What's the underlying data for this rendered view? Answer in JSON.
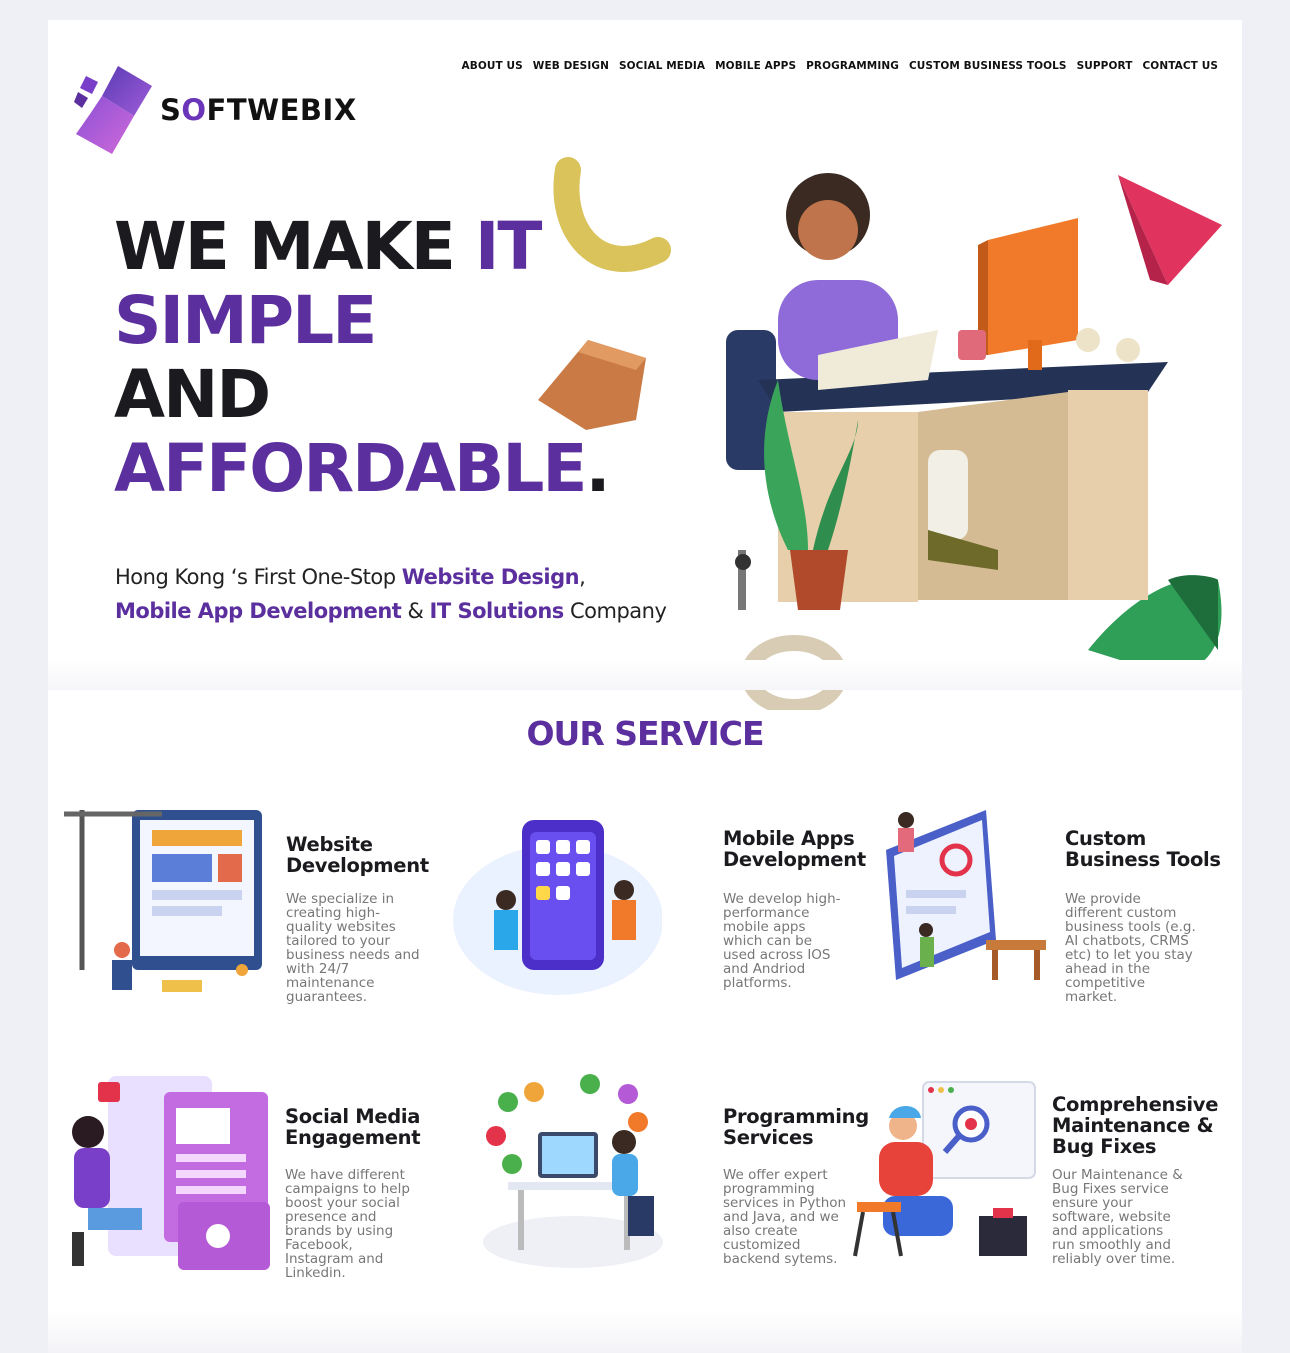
{
  "brand": {
    "name_pre": "S",
    "name_o": "O",
    "name_post": "FTWEBIX"
  },
  "nav": [
    {
      "label": "ABOUT US"
    },
    {
      "label": "WEB DESIGN"
    },
    {
      "label": "SOCIAL MEDIA"
    },
    {
      "label": "MOBILE APPS"
    },
    {
      "label": "PROGRAMMING"
    },
    {
      "label": "CUSTOM BUSINESS TOOLS"
    },
    {
      "label": "SUPPORT"
    },
    {
      "label": "CONTACT US"
    }
  ],
  "hero": {
    "line1_a": "WE MAKE ",
    "line1_b": "IT",
    "line2": "SIMPLE",
    "line3": "AND",
    "line4": "AFFORDABLE",
    "line4_dot": ".",
    "sub1_a": "Hong Kong ‘s First One-Stop ",
    "sub1_b": "Website Design",
    "sub1_c": ",",
    "sub2_a": "Mobile App Development",
    "sub2_b": " & ",
    "sub2_c": "IT Solutions",
    "sub2_d": " Company"
  },
  "services": {
    "title": "OUR SERVICE",
    "items": [
      {
        "title_1": "Website",
        "title_2": "Development",
        "title_3": "",
        "desc": [
          "We specialize in",
          "creating high-",
          "quality websites",
          "tailored to your",
          "business needs and",
          "with 24/7",
          "maintenance",
          "guarantees."
        ],
        "icon": "website-development-illustration"
      },
      {
        "title_1": "Mobile Apps",
        "title_2": "Development",
        "title_3": "",
        "desc": [
          "We develop high-",
          "performance",
          "mobile apps",
          "which can be",
          "used across IOS",
          "and Andriod",
          "platforms."
        ],
        "icon": "mobile-apps-illustration"
      },
      {
        "title_1": "Custom",
        "title_2": "Business Tools",
        "title_3": "",
        "desc": [
          "We provide",
          "different custom",
          "business tools (e.g.",
          "AI chatbots, CRMS",
          "etc) to let you stay",
          "ahead in the",
          "competitive",
          "market."
        ],
        "icon": "business-tools-illustration"
      },
      {
        "title_1": "Social Media",
        "title_2": "Engagement",
        "title_3": "",
        "desc": [
          "We have different",
          "campaigns to help",
          "boost your social",
          "presence and",
          "brands by using",
          "Facebook,",
          "Instagram and",
          "Linkedin."
        ],
        "icon": "social-media-illustration"
      },
      {
        "title_1": "Programming",
        "title_2": "Services",
        "title_3": "",
        "desc": [
          "We offer expert",
          "programming",
          "services in Python",
          "and Java, and we",
          "also create",
          "customized",
          "backend sytems."
        ],
        "icon": "programming-illustration"
      },
      {
        "title_1": "Comprehensive",
        "title_2": "Maintenance &",
        "title_3": "Bug Fixes",
        "desc": [
          "Our Maintenance &",
          "Bug Fixes service",
          "ensure your",
          "software, website",
          "and applications",
          "run smoothly and",
          "reliably over time."
        ],
        "icon": "maintenance-illustration"
      }
    ]
  }
}
